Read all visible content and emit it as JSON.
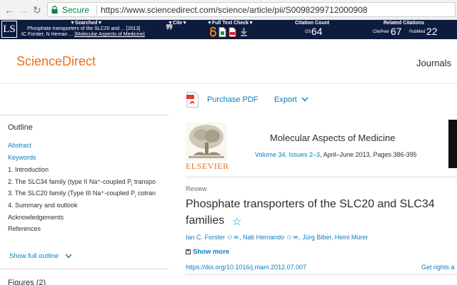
{
  "browser": {
    "secure_label": "Secure",
    "url": "https://www.sciencedirect.com/science/article/pii/S0098299712000908"
  },
  "extension_bar": {
    "logo": "LS",
    "searched_header": "▼Searched▼",
    "searched_line1": "Phosphate transporters of the SLC20 and ... [2013]",
    "searched_line2_prefix": "IC Forster, N Hernan ... ",
    "searched_line2_journal": "[Molecular Aspects of Medicine]",
    "cite_header": "▼Cite▼",
    "fulltext_header": "▼Full Text Check▼",
    "citation_count_header": "Citation Count",
    "gs_label": "GS",
    "gs_count": "64",
    "related_header": "Related Citations",
    "citepeer_label": "CitePeer",
    "citepeer_count": "67",
    "pubmed_label": "PubMed",
    "pubmed_count": "22"
  },
  "site": {
    "brand": "ScienceDirect",
    "journals": "Journals"
  },
  "actions": {
    "purchase_pdf": "Purchase PDF",
    "export": "Export"
  },
  "outline": {
    "title": "Outline",
    "items": [
      {
        "label": "Abstract"
      },
      {
        "label": "Keywords"
      },
      {
        "label": "1. Introduction"
      },
      {
        "label_a": "2. The SLC34 family (type II Na⁺-coupled P",
        "sub": "i",
        "label_b": " transpo"
      },
      {
        "label_a": "3. The SLC20 family (Type III Na⁺-coupled P",
        "sub": "i",
        "label_b": " cotran"
      },
      {
        "label": "4. Summary and outlook"
      },
      {
        "label": "Acknowledgements"
      },
      {
        "label": "References"
      }
    ],
    "show_full": "Show full outline",
    "figures": "Figures (2)"
  },
  "article": {
    "publisher": "ELSEVIER",
    "journal": "Molecular Aspects of Medicine",
    "volume_link": "Volume 34, Issues 2–3",
    "volume_rest": ", April–June 2013, Pages 386-395",
    "type": "Review",
    "title_line1": "Phosphate transporters of the SLC20 and SLC34",
    "title_line2": "families",
    "authors": [
      "Ian C. Forster",
      "Nati Hernando",
      "Jürg Biber",
      "Heini Murer"
    ],
    "show_more": "Show more",
    "doi": "https://doi.org/10.1016/j.mam.2012.07.007",
    "rights": "Get rights a"
  },
  "colors": {
    "brand_orange": "#e9711c",
    "link_blue": "#0c7dbb",
    "toolbar_navy": "#0d1b3e",
    "secure_green": "#0b8043"
  }
}
